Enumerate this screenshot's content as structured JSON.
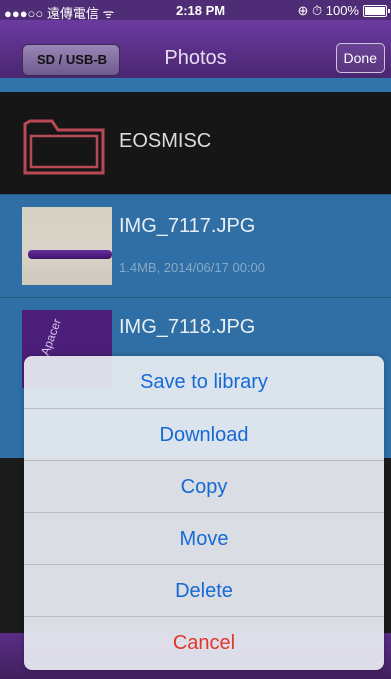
{
  "status_bar": {
    "carrier": "●●●○○ 遠傳電信 ᯤ",
    "time": "2:18 PM",
    "indicators": "⊕ ⏱ 100%"
  },
  "nav": {
    "back_label": "SD / USB-B",
    "title": "Photos",
    "done_label": "Done"
  },
  "files": [
    {
      "name": "EOSMISC",
      "icon": "folder-icon"
    },
    {
      "name": "IMG_7117.JPG",
      "meta": "1.4MB, 2014/06/17 00:00",
      "icon": "photo-thumbnail"
    },
    {
      "name": "IMG_7118.JPG",
      "icon": "photo-thumbnail",
      "thumb_text": "Apacer"
    }
  ],
  "action_sheet": {
    "items": [
      "Save to library",
      "Download",
      "Copy",
      "Move",
      "Delete"
    ],
    "cancel": "Cancel"
  },
  "colors": {
    "nav_purple": "#4a2670",
    "row_blue": "#2f6fa5",
    "action_blue": "#1569d6",
    "cancel_red": "#e2372a"
  }
}
